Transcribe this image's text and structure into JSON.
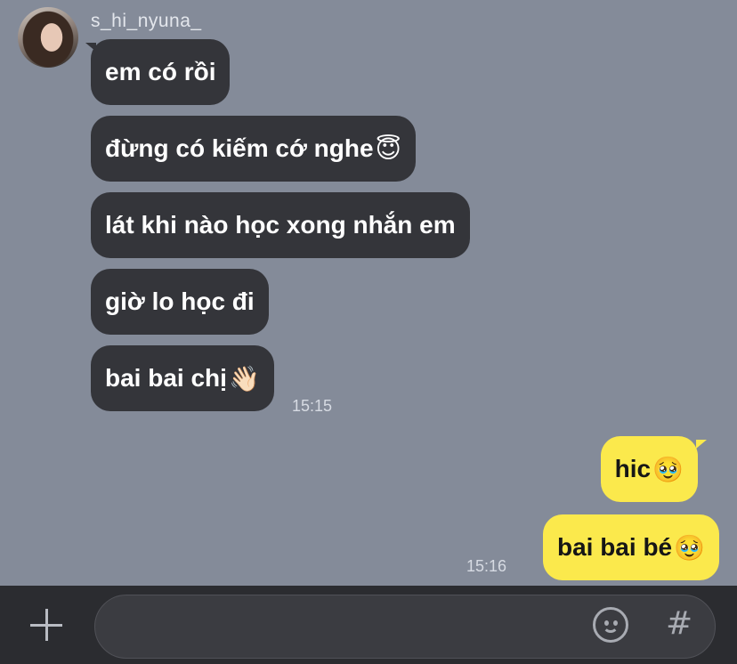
{
  "conversation": {
    "sender_name": "s_hi_nyuna_",
    "incoming": [
      {
        "text": "em có rồi",
        "emoji": ""
      },
      {
        "text": "đừng có kiếm cớ nghe",
        "emoji": "😇"
      },
      {
        "text": "lát khi nào học xong nhắn em",
        "emoji": ""
      },
      {
        "text": "giờ lo học đi",
        "emoji": ""
      },
      {
        "text": "bai bai chị",
        "emoji": "👋🏻"
      }
    ],
    "incoming_time": "15:15",
    "outgoing": [
      {
        "text": "hic ",
        "emoji": "🥹"
      },
      {
        "text": "bai bai bé",
        "emoji": "🥹"
      }
    ],
    "outgoing_time": "15:16"
  },
  "composer": {
    "input_value": "",
    "icons": [
      "plus-icon",
      "emoji-icon",
      "hashtag-icon"
    ],
    "hashtag_label": "#"
  },
  "colors": {
    "background": "#848b99",
    "incoming_bubble": "#34353a",
    "outgoing_bubble": "#fbe94c",
    "composer_bar": "#2b2c30"
  }
}
